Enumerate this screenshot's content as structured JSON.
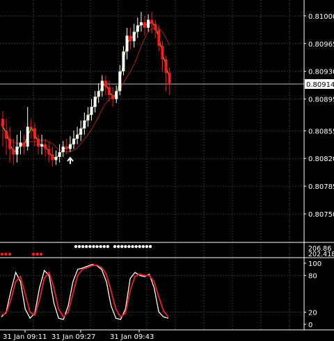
{
  "chart_data": [
    {
      "type": "candlestick",
      "price_ticks": [
        "0.81000",
        "0.80965",
        "0.80930",
        "0.80895",
        "0.80855",
        "0.80820",
        "0.80785",
        "0.80750"
      ],
      "ylim": [
        0.80715,
        0.8102
      ],
      "current_price": "0.80914",
      "time_labels": [
        "31 Jan 09:11",
        "31 Jan 09:27",
        "31 Jan 09:43"
      ],
      "up_color": "#ffffff",
      "down_color": "#ff1a1a",
      "ma_fast_color": "#7cfc00",
      "ma_slow_color": "#b22222",
      "candles": [
        [
          0.8087,
          0.8086,
          0.80835,
          0.8088
        ],
        [
          0.80855,
          0.80845,
          0.80825,
          0.8087
        ],
        [
          0.80845,
          0.80832,
          0.80815,
          0.8086
        ],
        [
          0.80832,
          0.80825,
          0.80812,
          0.80845
        ],
        [
          0.80825,
          0.80835,
          0.80815,
          0.8085
        ],
        [
          0.80835,
          0.8084,
          0.80825,
          0.80855
        ],
        [
          0.8084,
          0.80835,
          0.80825,
          0.8085
        ],
        [
          0.80835,
          0.8086,
          0.8083,
          0.80885
        ],
        [
          0.8086,
          0.80858,
          0.80845,
          0.8087
        ],
        [
          0.80858,
          0.80845,
          0.80835,
          0.80865
        ],
        [
          0.80845,
          0.80835,
          0.80825,
          0.8085
        ],
        [
          0.80835,
          0.80838,
          0.80825,
          0.8085
        ],
        [
          0.80838,
          0.80832,
          0.80822,
          0.80845
        ],
        [
          0.80832,
          0.80825,
          0.80815,
          0.8084
        ],
        [
          0.80825,
          0.80818,
          0.8081,
          0.80835
        ],
        [
          0.80818,
          0.80822,
          0.80812,
          0.8083
        ],
        [
          0.80822,
          0.80828,
          0.80815,
          0.80838
        ],
        [
          0.80828,
          0.80835,
          0.80822,
          0.80842
        ],
        [
          0.80835,
          0.80832,
          0.80825,
          0.80845
        ],
        [
          0.80832,
          0.80838,
          0.80828,
          0.80848
        ],
        [
          0.80838,
          0.80845,
          0.80832,
          0.80855
        ],
        [
          0.80845,
          0.8085,
          0.80838,
          0.8086
        ],
        [
          0.8085,
          0.80858,
          0.80842,
          0.80868
        ],
        [
          0.80858,
          0.80868,
          0.8085,
          0.80878
        ],
        [
          0.80868,
          0.80875,
          0.8086,
          0.80885
        ],
        [
          0.80875,
          0.80885,
          0.80868,
          0.80895
        ],
        [
          0.80885,
          0.80898,
          0.80878,
          0.80905
        ],
        [
          0.80898,
          0.80905,
          0.8089,
          0.80915
        ],
        [
          0.80905,
          0.80918,
          0.80898,
          0.80925
        ],
        [
          0.80918,
          0.8091,
          0.809,
          0.80925
        ],
        [
          0.8091,
          0.809,
          0.80892,
          0.80918
        ],
        [
          0.809,
          0.80895,
          0.80885,
          0.8091
        ],
        [
          0.80895,
          0.80905,
          0.8089,
          0.80912
        ],
        [
          0.80905,
          0.8093,
          0.809,
          0.80938
        ],
        [
          0.8093,
          0.80955,
          0.80925,
          0.80962
        ],
        [
          0.80955,
          0.80975,
          0.80945,
          0.80985
        ],
        [
          0.80975,
          0.80968,
          0.80958,
          0.80985
        ],
        [
          0.80968,
          0.8098,
          0.8096,
          0.8099
        ],
        [
          0.8098,
          0.80988,
          0.80972,
          0.80998
        ],
        [
          0.80988,
          0.80992,
          0.8098,
          0.81005
        ],
        [
          0.80992,
          0.80985,
          0.80975,
          0.81
        ],
        [
          0.80985,
          0.80995,
          0.8098,
          0.81002
        ],
        [
          0.80995,
          0.8099,
          0.80978,
          0.81005
        ],
        [
          0.8099,
          0.80982,
          0.80972,
          0.80995
        ],
        [
          0.80982,
          0.80962,
          0.80955,
          0.80988
        ],
        [
          0.80962,
          0.80945,
          0.8093,
          0.80968
        ],
        [
          0.80945,
          0.80928,
          0.80905,
          0.8095
        ],
        [
          0.80928,
          0.80915,
          0.809,
          0.80935
        ]
      ],
      "signal_markers": [
        {
          "candle": 19,
          "symbol": "up-arrow"
        }
      ]
    },
    {
      "type": "dot-indicator",
      "levels": [
        "206.86",
        "202.4182"
      ],
      "white_dot_groups": [
        [
          19,
          28
        ],
        [
          30,
          40
        ]
      ],
      "red_dot_groups": [
        [
          0,
          2
        ],
        [
          9,
          11
        ]
      ]
    },
    {
      "type": "line",
      "name": "stochastic",
      "ylim": [
        0,
        100
      ],
      "levels": [
        "100",
        "80",
        "20",
        "0"
      ],
      "series": [
        {
          "color": "#ffffff",
          "values": [
            12,
            20,
            55,
            85,
            70,
            25,
            10,
            18,
            60,
            88,
            80,
            35,
            10,
            8,
            30,
            70,
            90,
            92,
            95,
            98,
            96,
            90,
            70,
            30,
            10,
            8,
            25,
            75,
            85,
            80,
            78,
            82,
            60,
            20,
            12,
            10
          ]
        },
        {
          "color": "#e0201e",
          "values": [
            15,
            18,
            40,
            70,
            78,
            50,
            20,
            15,
            40,
            75,
            85,
            60,
            25,
            12,
            20,
            50,
            80,
            90,
            93,
            96,
            97,
            93,
            82,
            55,
            25,
            12,
            18,
            55,
            78,
            82,
            80,
            80,
            70,
            45,
            22,
            12
          ]
        }
      ]
    }
  ]
}
